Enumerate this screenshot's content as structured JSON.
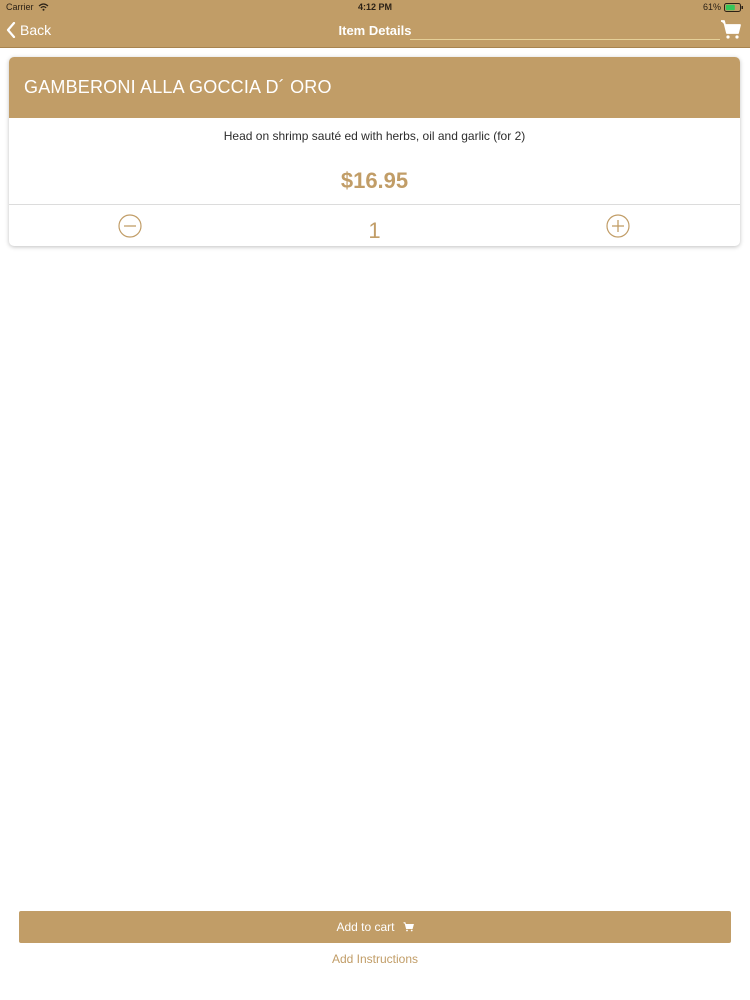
{
  "status_bar": {
    "carrier": "Carrier",
    "time": "4:12 PM",
    "battery": "61%",
    "wifi_icon": "wifi-icon",
    "battery_icon": "battery-icon"
  },
  "nav": {
    "back_label": "Back",
    "back_icon": "chevron-left-icon",
    "title": "Item Details",
    "cart_icon": "shopping-cart-icon"
  },
  "item": {
    "name": "GAMBERONI ALLA GOCCIA D´  ORO",
    "description": "Head on shrimp sauté ed with herbs, oil and garlic (for 2)",
    "price": "$16.95",
    "quantity": "1"
  },
  "quantity_controls": {
    "decrement_icon": "minus-circle-icon",
    "increment_icon": "plus-circle-icon"
  },
  "footer": {
    "add_to_cart_label": "Add to cart",
    "add_to_cart_icon": "shopping-cart-icon",
    "add_instructions_label": "Add Instructions"
  },
  "colors": {
    "accent": "#c19d67",
    "background": "#ffffff",
    "text": "#2d2d2d"
  }
}
